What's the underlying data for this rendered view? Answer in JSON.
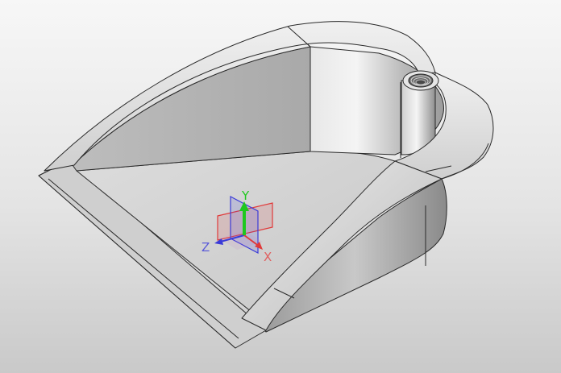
{
  "viewport": {
    "background_top": "#f7f7f7",
    "background_bottom": "#c9c9c9"
  },
  "model": {
    "shape": "scoop-shaped shell part with threaded boss",
    "face_color": "#d4d4d4",
    "edge_color": "#2a2a2a"
  },
  "triad": {
    "x_label": "X",
    "y_label": "Y",
    "z_label": "Z",
    "x_color": "#e03a3a",
    "y_color": "#1ec81e",
    "z_color": "#3a3ad8"
  }
}
